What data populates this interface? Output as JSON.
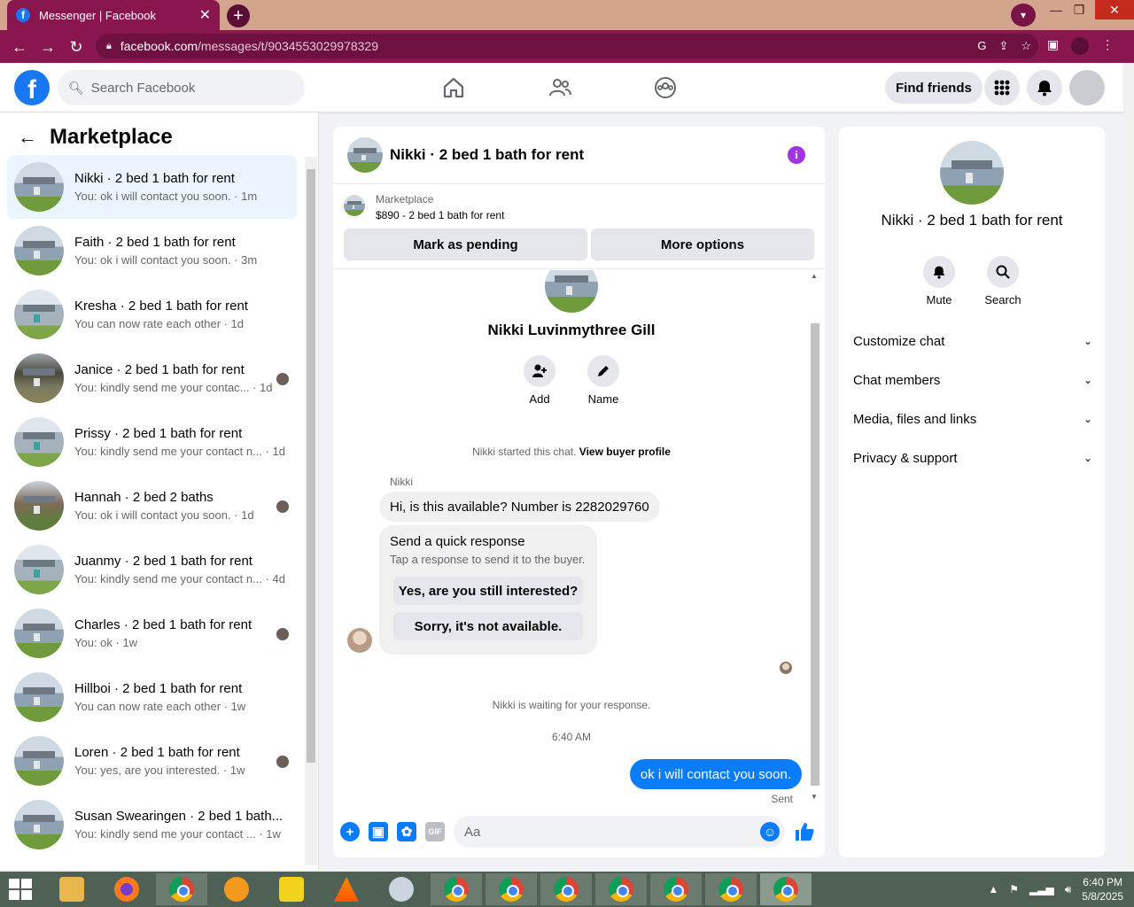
{
  "browser": {
    "tab_title": "Messenger | Facebook",
    "url_host": "facebook.com",
    "url_path": "/messages/t/9034553029978329"
  },
  "header": {
    "search_placeholder": "Search Facebook",
    "find_friends": "Find friends"
  },
  "left": {
    "title": "Marketplace",
    "conversations": [
      {
        "name": "Nikki · 2 bed 1 bath for rent",
        "preview": "You: ok i will contact you soon. · 1m",
        "seen": false,
        "active": true,
        "thumb": "house"
      },
      {
        "name": "Faith · 2 bed 1 bath for rent",
        "preview": "You: ok i will contact you soon. · 3m",
        "seen": false,
        "active": false,
        "thumb": "house"
      },
      {
        "name": "Kresha · 2 bed 1 bath for rent",
        "preview": "You can now rate each other · 1d",
        "seen": false,
        "active": false,
        "thumb": "alt"
      },
      {
        "name": "Janice · 2 bed 1 bath for rent",
        "preview": "You: kindly send me your contac... · 1d",
        "seen": true,
        "active": false,
        "thumb": "trees"
      },
      {
        "name": "Prissy · 2 bed 1 bath for rent",
        "preview": "You: kindly send me your contact n... · 1d",
        "seen": false,
        "active": false,
        "thumb": "alt"
      },
      {
        "name": "Hannah · 2 bed 2 baths",
        "preview": "You: ok i will contact you soon. · 1d",
        "seen": true,
        "active": false,
        "thumb": "brick"
      },
      {
        "name": "Juanmy · 2 bed 1 bath for rent",
        "preview": "You: kindly send me your contact n... · 4d",
        "seen": false,
        "active": false,
        "thumb": "alt"
      },
      {
        "name": "Charles · 2 bed 1 bath for rent",
        "preview": "You: ok · 1w",
        "seen": true,
        "active": false,
        "thumb": "house"
      },
      {
        "name": "Hillboi · 2 bed 1 bath for rent",
        "preview": "You can now rate each other · 1w",
        "seen": false,
        "active": false,
        "thumb": "house"
      },
      {
        "name": "Loren · 2 bed 1 bath for rent",
        "preview": "You: yes, are you interested. · 1w",
        "seen": true,
        "active": false,
        "thumb": "house"
      },
      {
        "name": "Susan Swearingen · 2 bed 1 bath...",
        "preview": "You: kindly send me your contact ... · 1w",
        "seen": false,
        "active": false,
        "thumb": "house"
      }
    ]
  },
  "chat": {
    "title": "Nikki · 2 bed 1 bath for rent",
    "listing_source": "Marketplace",
    "listing_price": "$890 - 2 bed 1 bath for rent",
    "mark_pending": "Mark as pending",
    "more_options": "More options",
    "profile_name": "Nikki Luvinmythree Gill",
    "add_label": "Add",
    "name_label": "Name",
    "started_text": "Nikki started this chat.",
    "view_profile": "View buyer profile",
    "sender": "Nikki",
    "incoming": "Hi, is this available? Number is 2282029760",
    "quick_title": "Send a quick response",
    "quick_sub": "Tap a response to send it to the buyer.",
    "quick_1": "Yes, are you still interested?",
    "quick_2": "Sorry, it's not available.",
    "waiting": "Nikki is waiting for your response.",
    "time": "6:40 AM",
    "outgoing": "ok i will contact you soon.",
    "sent": "Sent",
    "composer_placeholder": "Aa"
  },
  "right": {
    "title": "Nikki · 2 bed 1 bath for rent",
    "mute": "Mute",
    "search": "Search",
    "sections": [
      "Customize chat",
      "Chat members",
      "Media, files and links",
      "Privacy & support"
    ]
  },
  "taskbar": {
    "time": "6:40 PM",
    "date": "5/8/2025"
  },
  "colors": {
    "chrome_frame": "#8a1650",
    "fb_blue": "#1877f2",
    "messenger_blue": "#0a7cff"
  }
}
